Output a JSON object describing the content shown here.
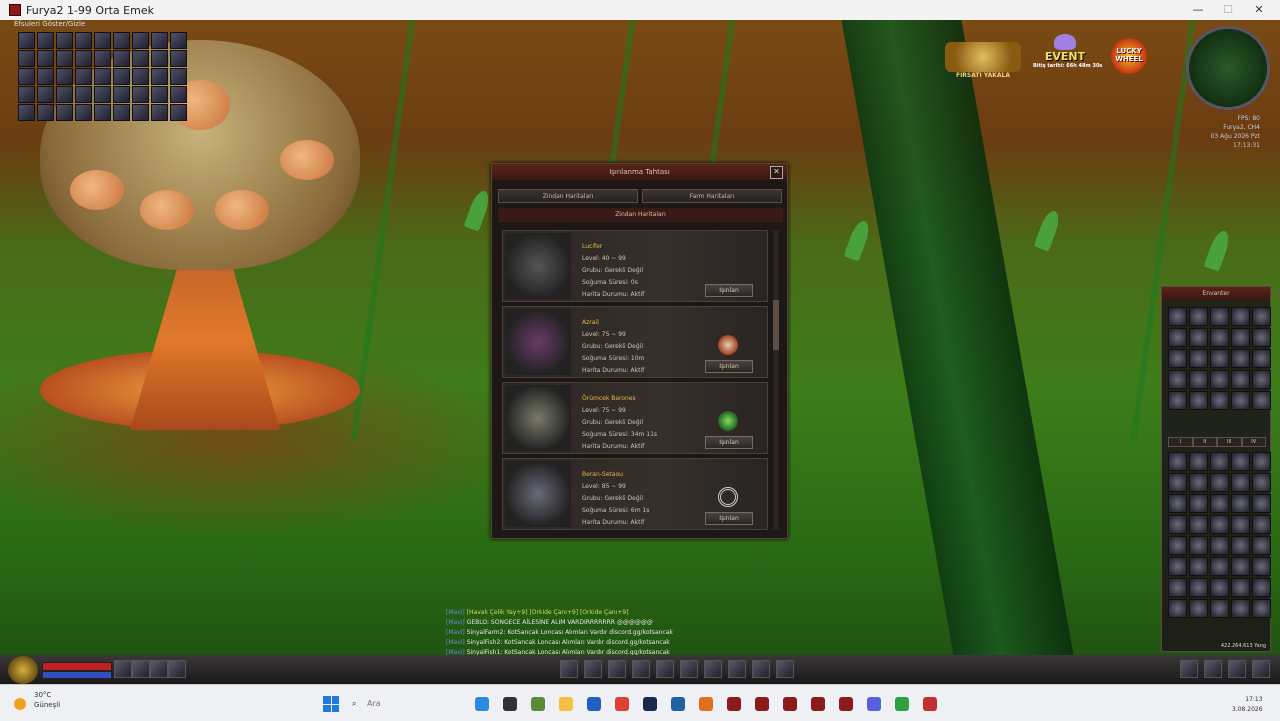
{
  "window": {
    "title": "Furya2 1-99 Orta Emek",
    "minimize": "—",
    "maximize": "☐",
    "close": "✕"
  },
  "skills": {
    "label": "Efsuleri Göster/Gizle"
  },
  "top_icons": {
    "left_caption": "FIRSATI YAKALA",
    "event": "EVENT",
    "event_timer": "Bitiş tarihi: 66h 48m 30s",
    "wheel": "LUCKY WHEEL"
  },
  "map_info": {
    "fps": "FPS: 80",
    "location": "Furya2, CH4",
    "date": "03 Ağu 2026 Pzt",
    "time": "17:13:31"
  },
  "teleport": {
    "title": "Işınlanma Tahtası",
    "tabs": [
      "Zindan Haritaları",
      "Farm Haritaları"
    ],
    "section": "Zindan Haritaları",
    "button": "Işınlan",
    "entries": [
      {
        "name": "Lucifer",
        "level": "Level: 40 ~ 99",
        "group": "Grubu: Gerekli Değil",
        "cooldown": "Soğuma Süresi: 0s",
        "status": "Harita Durumu: Aktif"
      },
      {
        "name": "Azrail",
        "level": "Level: 75 ~ 99",
        "group": "Grubu: Gerekli Değil",
        "cooldown": "Soğuma Süresi: 10m",
        "status": "Harita Durumu: Aktif"
      },
      {
        "name": "Örümcek Barones",
        "level": "Level: 75 ~ 99",
        "group": "Grubu: Gerekli Değil",
        "cooldown": "Soğuma Süresi: 34m 11s",
        "status": "Harita Durumu: Aktif"
      },
      {
        "name": "Beran-Setaou",
        "level": "Level: 85 ~ 99",
        "group": "Grubu: Gerekli Değil",
        "cooldown": "Soğuma Süresi: 6m 1s",
        "status": "Harita Durumu: Aktif"
      }
    ]
  },
  "inventory": {
    "title": "Envanter",
    "tabs": [
      "I",
      "II",
      "III",
      "IV"
    ],
    "gold": "422.264.613 Yang"
  },
  "chat": [
    {
      "channel": "[Mavi]",
      "text": "[Havalı Çelik Yay+9] [Orkide Çanı+9] [Orkide Çanı+9]"
    },
    {
      "channel": "[Mavi]",
      "text": "GEBLO: SONGECE AİLESİNE ALIM VARDIRRRRRRR @@@@@@"
    },
    {
      "channel": "[Mavi]",
      "text": "SinyalFarm2: KotSancak Loncası Alımları Vardır discord.gg/kotsancak"
    },
    {
      "channel": "[Mavi]",
      "text": "SinyalFish2: KotSancak Loncası Alımları Vardır discord.gg/kotsancak"
    },
    {
      "channel": "[Mavi]",
      "text": "SinyalFish1: KotSancak Loncası Alımları Vardır discord.gg/kotsancak"
    }
  ],
  "taskbar": {
    "temp": "30°C",
    "weather": "Güneşli",
    "search_placeholder": "Ara",
    "clock_time": "17:13",
    "clock_date": "3.08.2026"
  },
  "colors": {
    "accent_red": "#5a2418",
    "gold_text": "#e8b84a",
    "chat_channel": "#6a8ae0"
  }
}
